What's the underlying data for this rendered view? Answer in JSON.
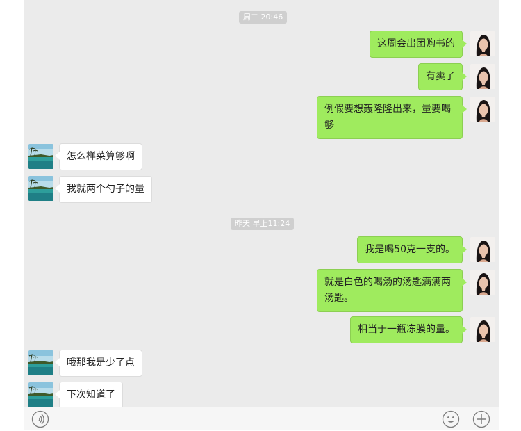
{
  "chat": {
    "timestamps": [
      "周二 20:46",
      "昨天 早上11:24"
    ],
    "messages": [
      {
        "sender": "me",
        "text": "这周会出团购书的"
      },
      {
        "sender": "me",
        "text": "有卖了"
      },
      {
        "sender": "me",
        "text": "例假要想轰隆隆出来，量要喝\n够"
      },
      {
        "sender": "them",
        "text": "怎么样菜算够啊"
      },
      {
        "sender": "them",
        "text": "我就两个勺子的量"
      },
      {
        "sender": "me",
        "text": "我是喝50克一支的。"
      },
      {
        "sender": "me",
        "text": "就是白色的喝汤的汤匙满满两\n汤匙。"
      },
      {
        "sender": "me",
        "text": "相当于一瓶冻膜的量。"
      },
      {
        "sender": "them",
        "text": "哦那我是少了点"
      },
      {
        "sender": "them",
        "text": "下次知道了"
      }
    ]
  },
  "toolbar": {
    "icons": [
      "voice-icon",
      "emoji-icon",
      "plus-icon"
    ]
  },
  "colors": {
    "chat_background": "#ebebeb",
    "my_bubble": "#9feb5e",
    "their_bubble": "#ffffff",
    "timestamp_background": "#cfcfcf"
  }
}
